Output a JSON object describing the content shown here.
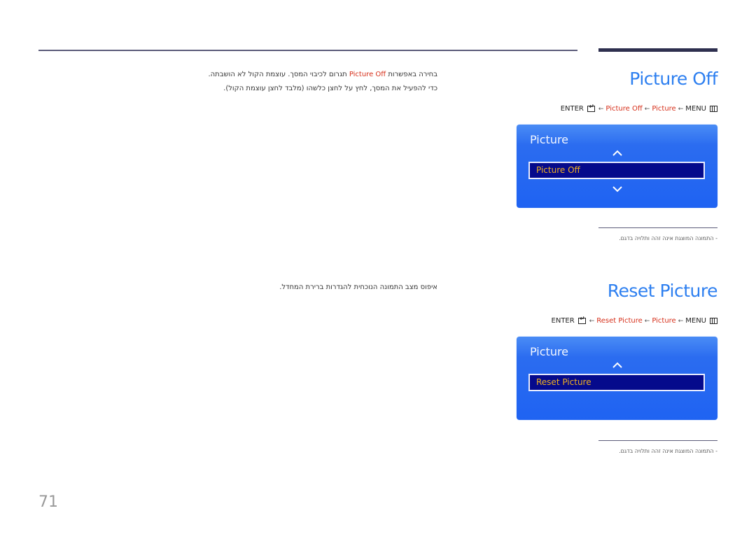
{
  "sections": [
    {
      "title": "Picture Off",
      "description": {
        "line1_prefix": "בחירה באפשרות ",
        "line1_highlight": "Picture Off",
        "line1_suffix": " תגרום לכיבוי המסך. עוצמת הקול לא הושבתה.",
        "line2": "כדי להפעיל את המסך, לחץ על לחצן כלשהו (מלבד לחצן עוצמת הקול)."
      },
      "breadcrumb": {
        "menu": "MENU",
        "menu_icon": "menu-icon",
        "arrow": "←",
        "items": [
          "Picture",
          "Picture Off"
        ],
        "enter": "ENTER",
        "enter_icon": "enter-icon"
      },
      "osd": {
        "title": "Picture",
        "selected_item": "Picture Off",
        "show_up": true,
        "show_down": true
      },
      "note": "- התמונה המוצגת אינה זהה ותלויה בדגם."
    },
    {
      "title": "Reset Picture",
      "description": {
        "line1": "איפוס מצב התמונה הנוכחית להגדרות ברירת המחדל."
      },
      "breadcrumb": {
        "menu": "MENU",
        "menu_icon": "menu-icon",
        "arrow": "←",
        "items": [
          "Picture",
          "Reset Picture"
        ],
        "enter": "ENTER",
        "enter_icon": "enter-icon"
      },
      "osd": {
        "title": "Picture",
        "selected_item": "Reset Picture",
        "show_up": true,
        "show_down": false
      },
      "note": "- התמונה המוצגת אינה זהה ותלויה בדגם."
    }
  ],
  "page_number": "71",
  "colors": {
    "title_blue": "#2d7ff0",
    "highlight_red": "#d62f1a",
    "osd_blue": "#1f63f2",
    "osd_item_bg": "#050a8c",
    "osd_item_text": "#f0b020"
  }
}
